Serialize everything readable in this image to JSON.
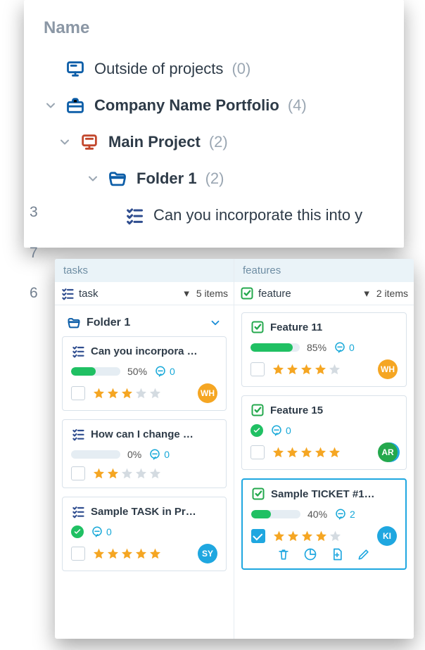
{
  "tree": {
    "header": "Name",
    "gutter": [
      "3",
      "7",
      "6"
    ],
    "items": [
      {
        "icon": "screen-icon",
        "iconColor": "#0d5ea8",
        "label": "Outside of projects",
        "count": "(0)",
        "bold": false,
        "chev": false,
        "indent": 0
      },
      {
        "icon": "briefcase-icon",
        "iconColor": "#0d5ea8",
        "label": "Company Name  Portfolio",
        "count": "(4)",
        "bold": true,
        "chev": true,
        "indent": 0
      },
      {
        "icon": "board-icon",
        "iconColor": "#c2472c",
        "label": "Main Project",
        "count": "(2)",
        "bold": true,
        "chev": true,
        "indent": 1
      },
      {
        "icon": "folder-open-icon",
        "iconColor": "#0d5ea8",
        "label": "Folder 1",
        "count": "(2)",
        "bold": true,
        "chev": true,
        "indent": 2
      },
      {
        "icon": "checklist-icon",
        "iconColor": "#2f4d8f",
        "label": "Can you incorporate this into y",
        "count": "",
        "bold": false,
        "chev": false,
        "indent": 3
      }
    ]
  },
  "board": {
    "columns": [
      {
        "head": "tasks",
        "type_icon": "checklist-icon",
        "type_icon_color": "#2f4d8f",
        "type_label": "task",
        "count": "5 items",
        "folder": {
          "label": "Folder 1"
        },
        "cards": [
          {
            "icon": "checklist-icon",
            "icon_color": "#2f4d8f",
            "title": "Can you incorpora …",
            "progress": 50,
            "pct": "50%",
            "comments": "0",
            "done": false,
            "stars": 3,
            "avatar": "WH",
            "avatar_bg": "#f5a623",
            "checked": false,
            "selected": false
          },
          {
            "icon": "checklist-icon",
            "icon_color": "#2f4d8f",
            "title": "How can I change  …",
            "progress": 0,
            "pct": "0%",
            "comments": "0",
            "done": false,
            "stars": 2,
            "avatar": "",
            "avatar_bg": "",
            "checked": false,
            "selected": false
          },
          {
            "icon": "checklist-icon",
            "icon_color": "#2f4d8f",
            "title": "Sample TASK in Pr…",
            "progress": 100,
            "pct": "",
            "comments": "0",
            "done": true,
            "stars": 5,
            "avatar": "SY",
            "avatar_bg": "#1fa7e0",
            "checked": false,
            "selected": false
          }
        ]
      },
      {
        "head": "features",
        "type_icon": "check-square-icon",
        "type_icon_color": "#24a84d",
        "type_label": "feature",
        "count": "2 items",
        "cards": [
          {
            "icon": "check-square-icon",
            "icon_color": "#24a84d",
            "title": "Feature 11",
            "progress": 85,
            "pct": "85%",
            "comments": "0",
            "done": false,
            "stars": 4,
            "avatar": "WH",
            "avatar_bg": "#f5a623",
            "checked": false,
            "selected": false
          },
          {
            "icon": "check-square-icon",
            "icon_color": "#24a84d",
            "title": "Feature 15",
            "progress": 100,
            "pct": "",
            "comments": "0",
            "done": true,
            "stars": 5,
            "avatar": "AR",
            "avatar_bg": "#24a84d",
            "avatar_bg2": "#1fa7e0",
            "checked": false,
            "selected": false
          },
          {
            "icon": "check-square-icon",
            "icon_color": "#24a84d",
            "title": "Sample TICKET #1…",
            "progress": 40,
            "pct": "40%",
            "comments": "2",
            "done": false,
            "stars": 4,
            "avatar": "KI",
            "avatar_bg": "#1fa7e0",
            "checked": true,
            "selected": true,
            "tools": [
              "trash-icon",
              "chart-icon",
              "add-file-icon",
              "pencil-icon"
            ]
          }
        ]
      }
    ]
  },
  "colors": {
    "star_on": "#f5a623",
    "star_off": "#d4dbe1",
    "blue": "#1fa7e0",
    "green": "#20c063"
  }
}
